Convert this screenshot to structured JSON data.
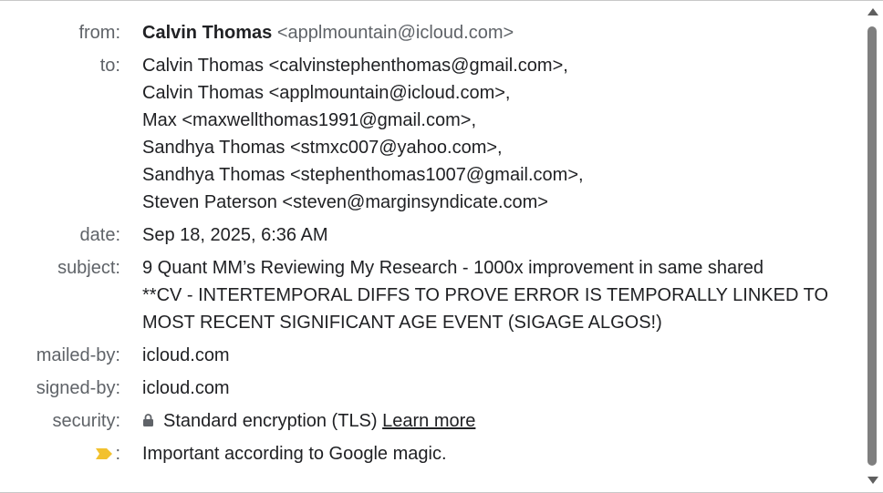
{
  "labels": {
    "from": "from:",
    "to": "to:",
    "date": "date:",
    "subject": "subject:",
    "mailed_by": "mailed-by:",
    "signed_by": "signed-by:",
    "security": "security:",
    "important_colon": ":"
  },
  "from": {
    "name": "Calvin Thomas",
    "address": "<applmountain@icloud.com>"
  },
  "to": [
    "Calvin Thomas <calvinstephenthomas@gmail.com>,",
    "Calvin Thomas <applmountain@icloud.com>,",
    "Max <maxwellthomas1991@gmail.com>,",
    "Sandhya Thomas <stmxc007@yahoo.com>,",
    "Sandhya Thomas <stephenthomas1007@gmail.com>,",
    "Steven Paterson <steven@marginsyndicate.com>"
  ],
  "date": "Sep 18, 2025, 6:36 AM",
  "subject_lines": [
    "9 Quant MM’s Reviewing My Research - 1000x improvement in same shared",
    "**CV - INTERTEMPORAL DIFFS TO PROVE ERROR IS TEMPORALLY LINKED TO",
    "MOST RECENT SIGNIFICANT AGE EVENT (SIGAGE ALGOS!)"
  ],
  "mailed_by": "icloud.com",
  "signed_by": "icloud.com",
  "security": {
    "icon": "lock-icon",
    "text": "Standard encryption (TLS)",
    "link": "Learn more"
  },
  "important": {
    "icon": "importance-marker-icon",
    "text": "Important according to Google magic."
  },
  "colors": {
    "label": "#5f6368",
    "text": "#202124",
    "importance": "#f2c12e",
    "scrollbar": "#7f7f7f"
  }
}
